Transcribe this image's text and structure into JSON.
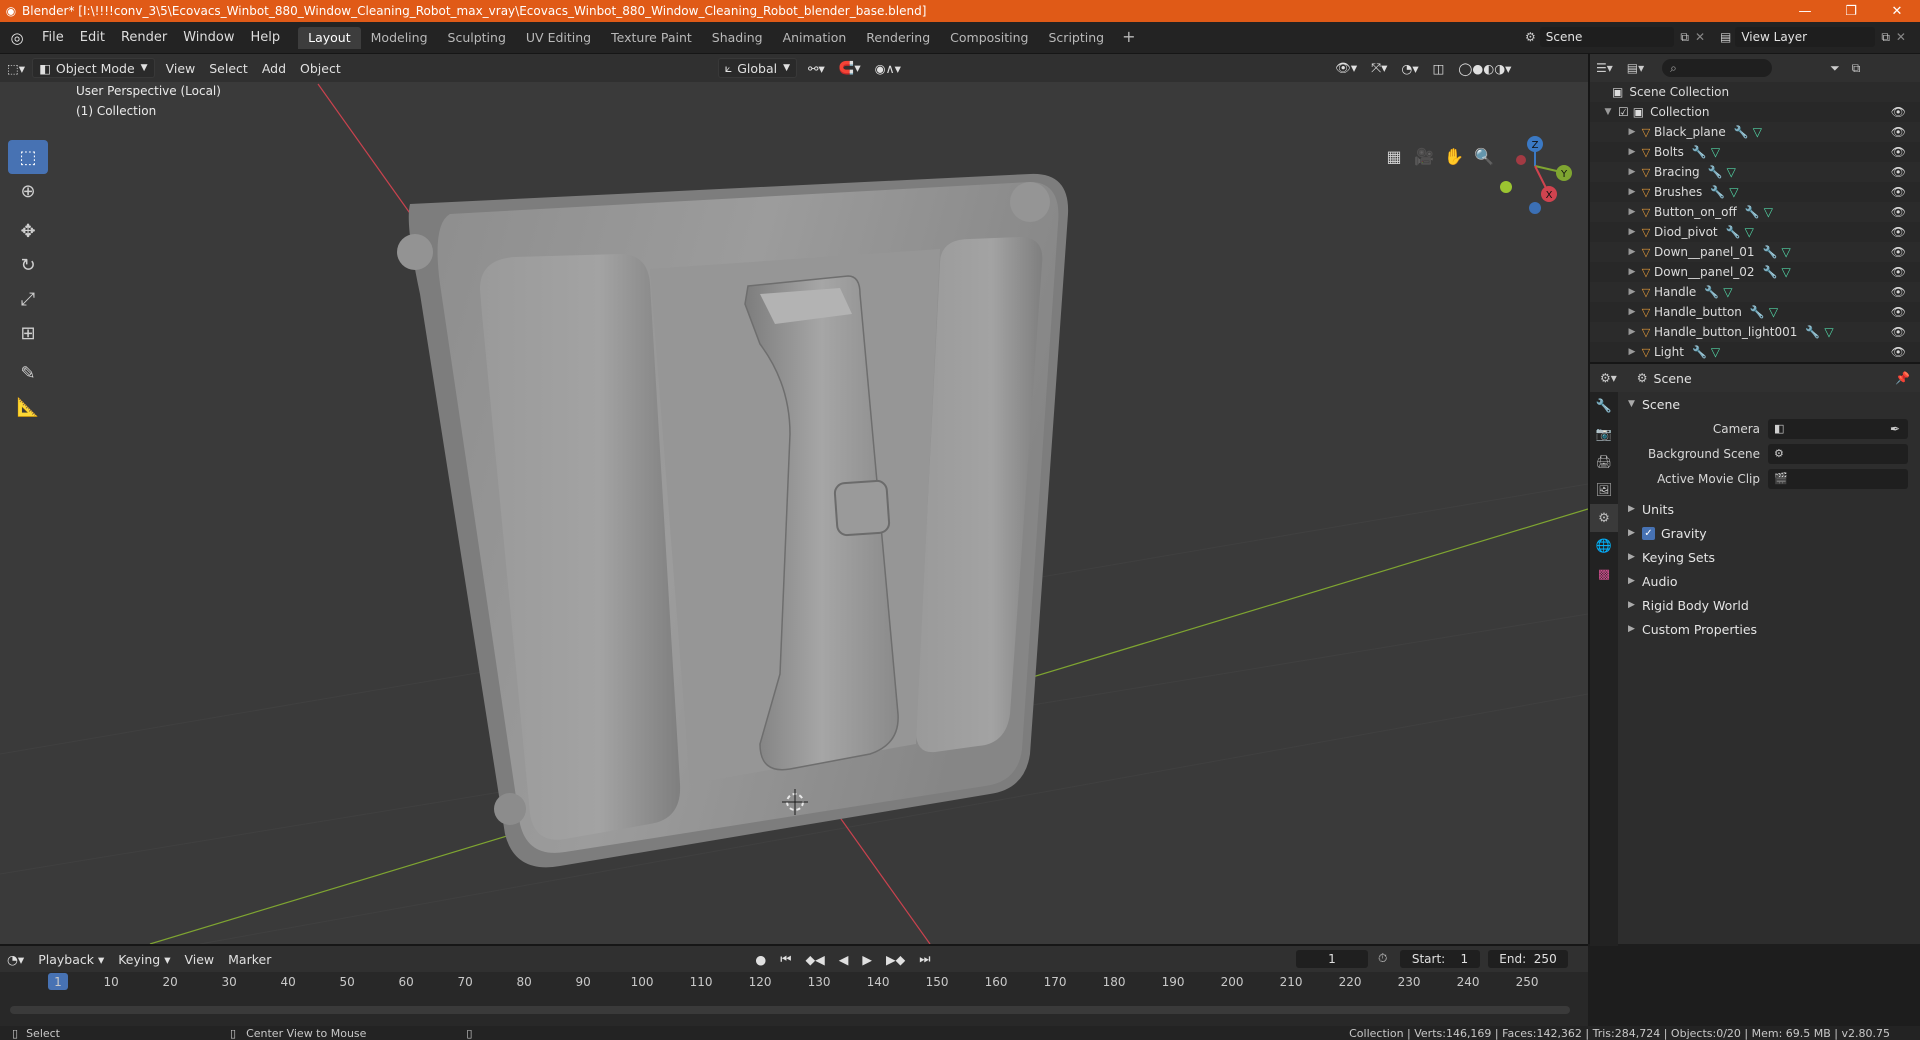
{
  "titlebar": {
    "title": "Blender* [I:\\!!!!conv_3\\5\\Ecovacs_Winbot_880_Window_Cleaning_Robot_max_vray\\Ecovacs_Winbot_880_Window_Cleaning_Robot_blender_base.blend]",
    "minimize": "—",
    "maximize": "❐",
    "close": "✕"
  },
  "menu": [
    "File",
    "Edit",
    "Render",
    "Window",
    "Help"
  ],
  "workspaces": [
    "Layout",
    "Modeling",
    "Sculpting",
    "UV Editing",
    "Texture Paint",
    "Shading",
    "Animation",
    "Rendering",
    "Compositing",
    "Scripting"
  ],
  "active_workspace": "Layout",
  "scene_name": "Scene",
  "view_layer": "View Layer",
  "viewport_header": {
    "mode": "Object Mode",
    "menus": [
      "View",
      "Select",
      "Add",
      "Object"
    ],
    "transform_orientation": "Global"
  },
  "viewport": {
    "perspective": "User Perspective (Local)",
    "collection": "(1) Collection",
    "axis_x": "X",
    "axis_y": "Y",
    "axis_z": "Z"
  },
  "outliner": {
    "root": "Scene Collection",
    "collection": "Collection",
    "objects": [
      "Black_plane",
      "Bolts",
      "Bracing",
      "Brushes",
      "Button_on_off",
      "Diod_pivot",
      "Down__panel_01",
      "Down__panel_02",
      "Handle",
      "Handle_button",
      "Handle_button_light001",
      "Light"
    ]
  },
  "properties": {
    "header": "Scene",
    "panel": "Scene",
    "camera_label": "Camera",
    "background_scene_label": "Background Scene",
    "movie_clip_label": "Active Movie Clip",
    "sections": [
      "Units",
      "Gravity",
      "Keying Sets",
      "Audio",
      "Rigid Body World",
      "Custom Properties"
    ]
  },
  "timeline": {
    "menus": [
      "Playback",
      "Keying",
      "View",
      "Marker"
    ],
    "current_frame": "1",
    "start_label": "Start:",
    "start": "1",
    "end_label": "End:",
    "end": "250",
    "ticks": [
      "1",
      "10",
      "20",
      "30",
      "40",
      "50",
      "60",
      "70",
      "80",
      "90",
      "100",
      "110",
      "120",
      "130",
      "140",
      "150",
      "160",
      "170",
      "180",
      "190",
      "200",
      "210",
      "220",
      "230",
      "240",
      "250"
    ]
  },
  "statusbar": {
    "select": "Select",
    "center_view": "Center View to Mouse",
    "stats": "Collection | Verts:146,169 | Faces:142,362 | Tris:284,724 | Objects:0/20 | Mem: 69.5 MB | v2.80.75"
  },
  "colors": {
    "titlebar": "#e05a17",
    "accent": "#4772b3",
    "viewport_bg": "#3a3a3a",
    "x_axis": "#d0434f",
    "y_axis": "#7fa531"
  }
}
